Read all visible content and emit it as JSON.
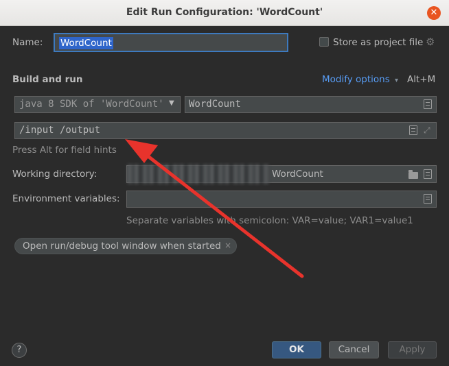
{
  "window": {
    "title": "Edit Run Configuration: 'WordCount'",
    "close_glyph": "✕"
  },
  "name": {
    "label": "Name:",
    "value": "WordCount"
  },
  "store": {
    "label": "Store as project file",
    "checked": false
  },
  "build": {
    "title": "Build and run",
    "modify_options": "Modify options",
    "modify_shortcut": "Alt+M",
    "jdk_value": "java 8  SDK of 'WordCount'",
    "main_class": "WordCount",
    "program_args": "/input /output",
    "hint": "Press Alt for field hints"
  },
  "working_directory": {
    "label": "Working directory:",
    "value_visible_suffix": "WordCount"
  },
  "env": {
    "label": "Environment variables:",
    "value": "",
    "hint": "Separate variables with semicolon: VAR=value; VAR1=value1"
  },
  "chip": {
    "label": "Open run/debug tool window when started",
    "remove_glyph": "×"
  },
  "footer": {
    "help_glyph": "?",
    "ok": "OK",
    "cancel": "Cancel",
    "apply": "Apply"
  },
  "colors": {
    "background": "#2b2b2b",
    "accent": "#589df6",
    "arrow": "#e8332c",
    "ok_button": "#365880"
  },
  "annotation": {
    "type": "arrow",
    "color": "#e8332c"
  }
}
